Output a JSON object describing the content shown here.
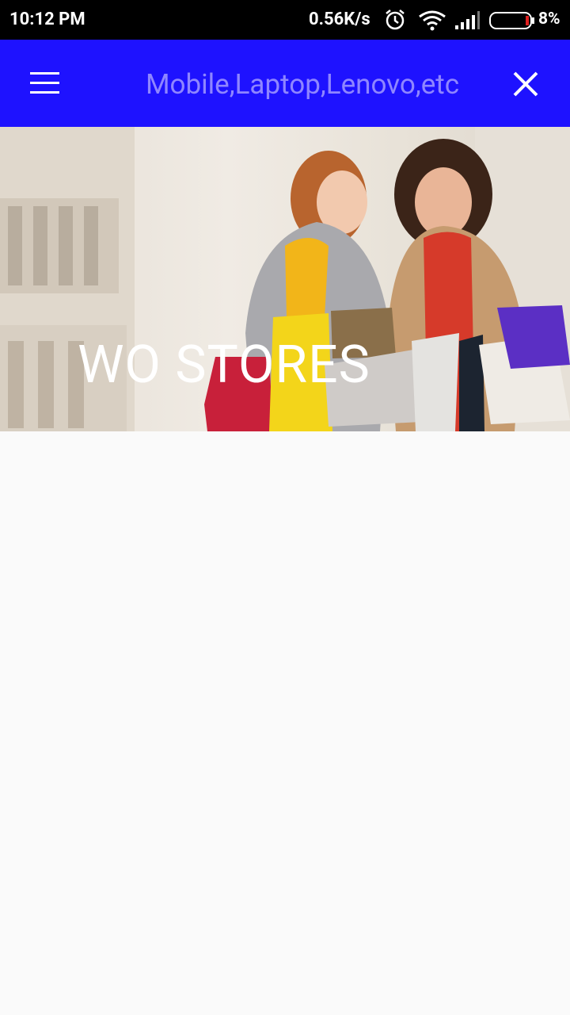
{
  "status_bar": {
    "time": "10:12 PM",
    "network_speed": "0.56K/s",
    "battery_percent": "8%",
    "icons": [
      "alarm-icon",
      "wifi-icon",
      "signal-icon",
      "battery-icon"
    ]
  },
  "app_bar": {
    "background": "#1e12ff",
    "search_placeholder": "Mobile,Laptop,Lenovo,etc",
    "icons": [
      "menu-icon",
      "close-icon"
    ]
  },
  "banner": {
    "title": "WO STORES"
  }
}
